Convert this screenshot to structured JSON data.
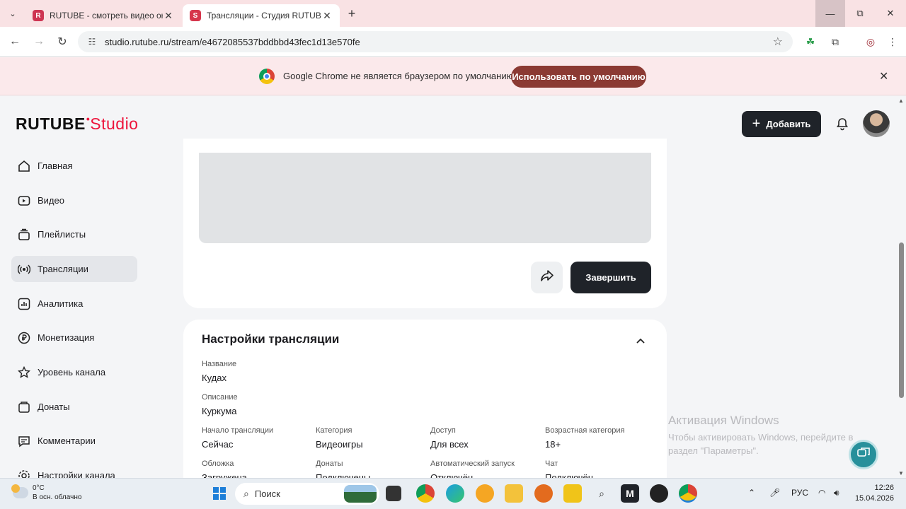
{
  "browser": {
    "tabs": [
      {
        "title": "RUTUBE - смотреть видео онлайн",
        "favicon": "rutube-icon"
      },
      {
        "title": "Трансляции - Студия RUTUBE",
        "favicon": "rutube-studio-icon"
      }
    ],
    "url": "studio.rutube.ru/stream/e4672085537bddbbd43fec1d13e570fe",
    "infobar": {
      "message": "Google Chrome не является браузером по умолчанию.",
      "button": "Использовать по умолчанию"
    }
  },
  "header": {
    "logo_main": "RUTUBE",
    "logo_dot": "•",
    "logo_studio": "Studio",
    "add_button": "Добавить"
  },
  "sidebar": {
    "items": [
      {
        "label": "Главная",
        "icon": "home-icon"
      },
      {
        "label": "Видео",
        "icon": "video-icon"
      },
      {
        "label": "Плейлисты",
        "icon": "playlist-icon"
      },
      {
        "label": "Трансляции",
        "icon": "broadcast-icon",
        "active": true
      },
      {
        "label": "Аналитика",
        "icon": "analytics-icon"
      },
      {
        "label": "Монетизация",
        "icon": "ruble-icon"
      },
      {
        "label": "Уровень канала",
        "icon": "star-icon"
      },
      {
        "label": "Донаты",
        "icon": "donate-icon"
      },
      {
        "label": "Комментарии",
        "icon": "comments-icon"
      },
      {
        "label": "Настройки канала",
        "icon": "settings-icon"
      }
    ]
  },
  "stream_card": {
    "end_button": "Завершить"
  },
  "settings": {
    "title": "Настройки трансляции",
    "name": {
      "label": "Название",
      "value": "Кудах"
    },
    "description": {
      "label": "Описание",
      "value": "Куркума"
    },
    "start": {
      "label": "Начало трансляции",
      "value": "Сейчас"
    },
    "category": {
      "label": "Категория",
      "value": "Видеоигры"
    },
    "access": {
      "label": "Доступ",
      "value": "Для всех"
    },
    "age": {
      "label": "Возрастная категория",
      "value": "18+"
    },
    "cover": {
      "label": "Обложка",
      "value": "Загружена"
    },
    "donates": {
      "label": "Донаты",
      "value": "Подключены"
    },
    "autostart": {
      "label": "Автоматический запуск",
      "value": "Отключён"
    },
    "chat": {
      "label": "Чат",
      "value": "Подключён"
    }
  },
  "watermark": {
    "line1": "Активация Windows",
    "line2": "Чтобы активировать Windows, перейдите в",
    "line3": "раздел \"Параметры\"."
  },
  "taskbar": {
    "temperature": "0°C",
    "weather": "В осн. облачно",
    "search_placeholder": "Поиск",
    "language": "РУС",
    "time": "12:26",
    "date": "15.04.2026"
  },
  "colors": {
    "accent": "#ed143b",
    "dark_button": "#1f2329",
    "infobar_button": "#8b3a33"
  }
}
